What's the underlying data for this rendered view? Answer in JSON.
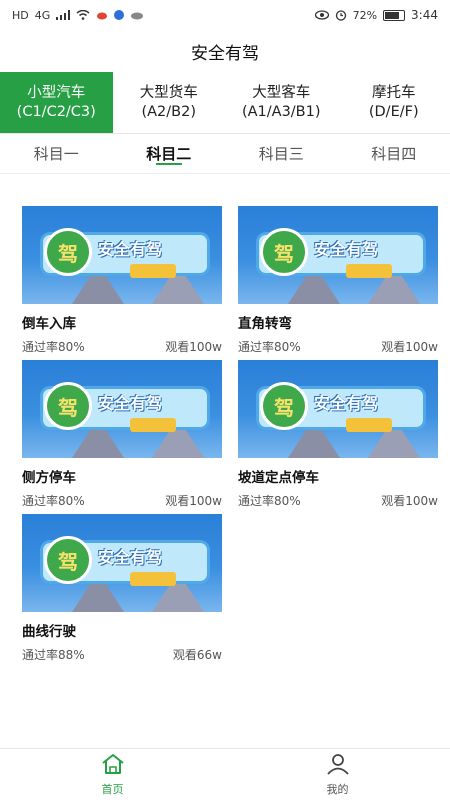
{
  "status_bar": {
    "left_indicators": [
      "HD",
      "4G"
    ],
    "battery": "72%",
    "time": "3:44"
  },
  "app": {
    "title": "安全有驾"
  },
  "vehicle_tabs": [
    {
      "line1": "小型汽车",
      "line2": "(C1/C2/C3)",
      "active": true
    },
    {
      "line1": "大型货车",
      "line2": "(A2/B2)",
      "active": false
    },
    {
      "line1": "大型客车",
      "line2": "(A1/A3/B1)",
      "active": false
    },
    {
      "line1": "摩托车",
      "line2": "(D/E/F)",
      "active": false
    }
  ],
  "subject_tabs": [
    {
      "label": "科目一",
      "active": false
    },
    {
      "label": "科目二",
      "active": true
    },
    {
      "label": "科目三",
      "active": false
    },
    {
      "label": "科目四",
      "active": false
    }
  ],
  "thumbnail": {
    "badge_char": "驾",
    "brand_text": "安全有驾"
  },
  "items": [
    {
      "title": "倒车入库",
      "pass_rate": "通过率80%",
      "views": "观看100w"
    },
    {
      "title": "直角转弯",
      "pass_rate": "通过率80%",
      "views": "观看100w"
    },
    {
      "title": "侧方停车",
      "pass_rate": "通过率80%",
      "views": "观看100w"
    },
    {
      "title": "坡道定点停车",
      "pass_rate": "通过率80%",
      "views": "观看100w"
    },
    {
      "title": "曲线行驶",
      "pass_rate": "通过率88%",
      "views": "观看66w"
    }
  ],
  "bottom_nav": [
    {
      "label": "首页",
      "icon": "home-icon",
      "active": true
    },
    {
      "label": "我的",
      "icon": "user-icon",
      "active": false
    }
  ],
  "colors": {
    "accent": "#27a045"
  }
}
